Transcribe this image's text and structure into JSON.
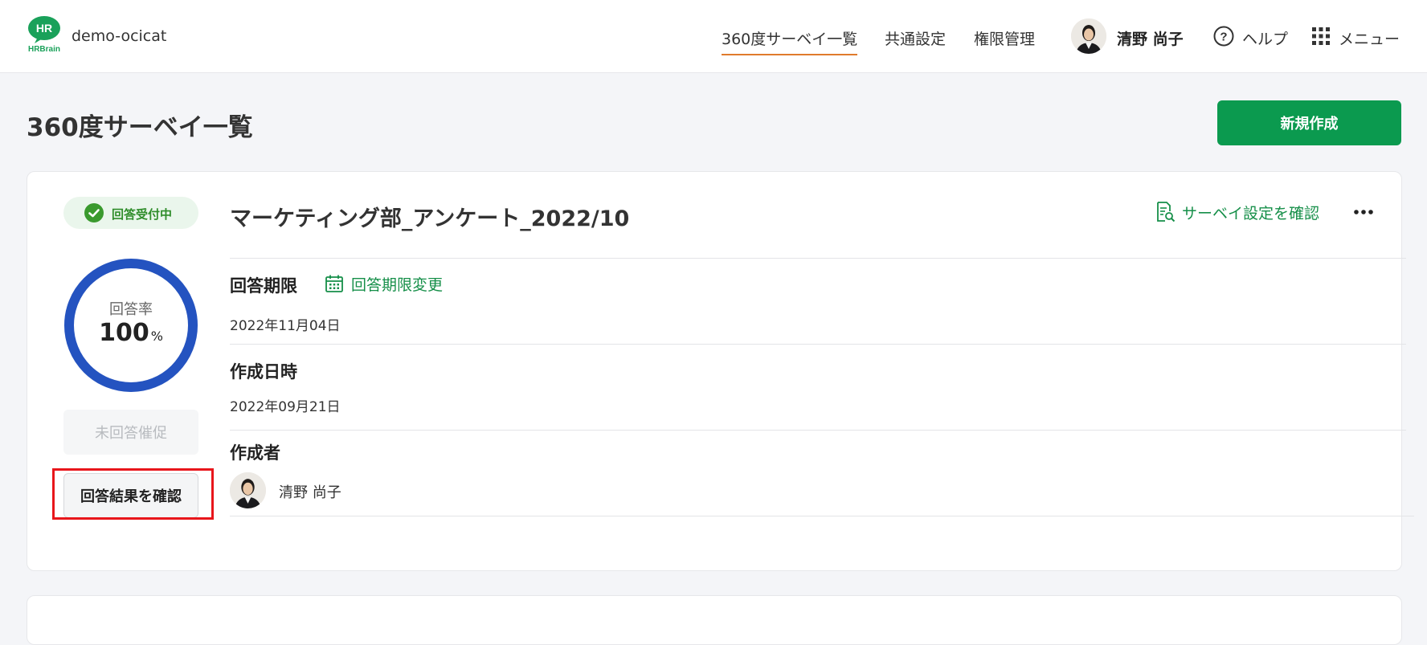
{
  "header": {
    "logo_text": "HR",
    "logo_subtext": "HRBrain",
    "org_name": "demo-ocicat",
    "nav": [
      {
        "label": "360度サーベイ一覧",
        "active": true
      },
      {
        "label": "共通設定",
        "active": false
      },
      {
        "label": "権限管理",
        "active": false
      }
    ],
    "user_name": "清野 尚子",
    "help_label": "ヘルプ",
    "menu_label": "メニュー",
    "accent_color": "#e07b2c"
  },
  "page": {
    "title": "360度サーベイ一覧",
    "new_button_label": "新規作成",
    "brand_color": "#0b9a4f"
  },
  "survey": {
    "status": "回答受付中",
    "status_color": "#2f8d2a",
    "title": "マーケティング部_アンケート_2022/10",
    "settings_link": "サーベイ設定を確認",
    "response_rate_label": "回答率",
    "response_rate_value": "100",
    "response_rate_unit": "%",
    "response_rate_fraction": 1.0,
    "ring_color": "#2453c0",
    "remind_button": "未回答催促",
    "results_button": "回答結果を確認",
    "deadline_label": "回答期限",
    "deadline_change": "回答期限変更",
    "deadline_value": "2022年11月04日",
    "created_label": "作成日時",
    "created_value": "2022年09月21日",
    "creator_label": "作成者",
    "creator_name": "清野 尚子"
  }
}
